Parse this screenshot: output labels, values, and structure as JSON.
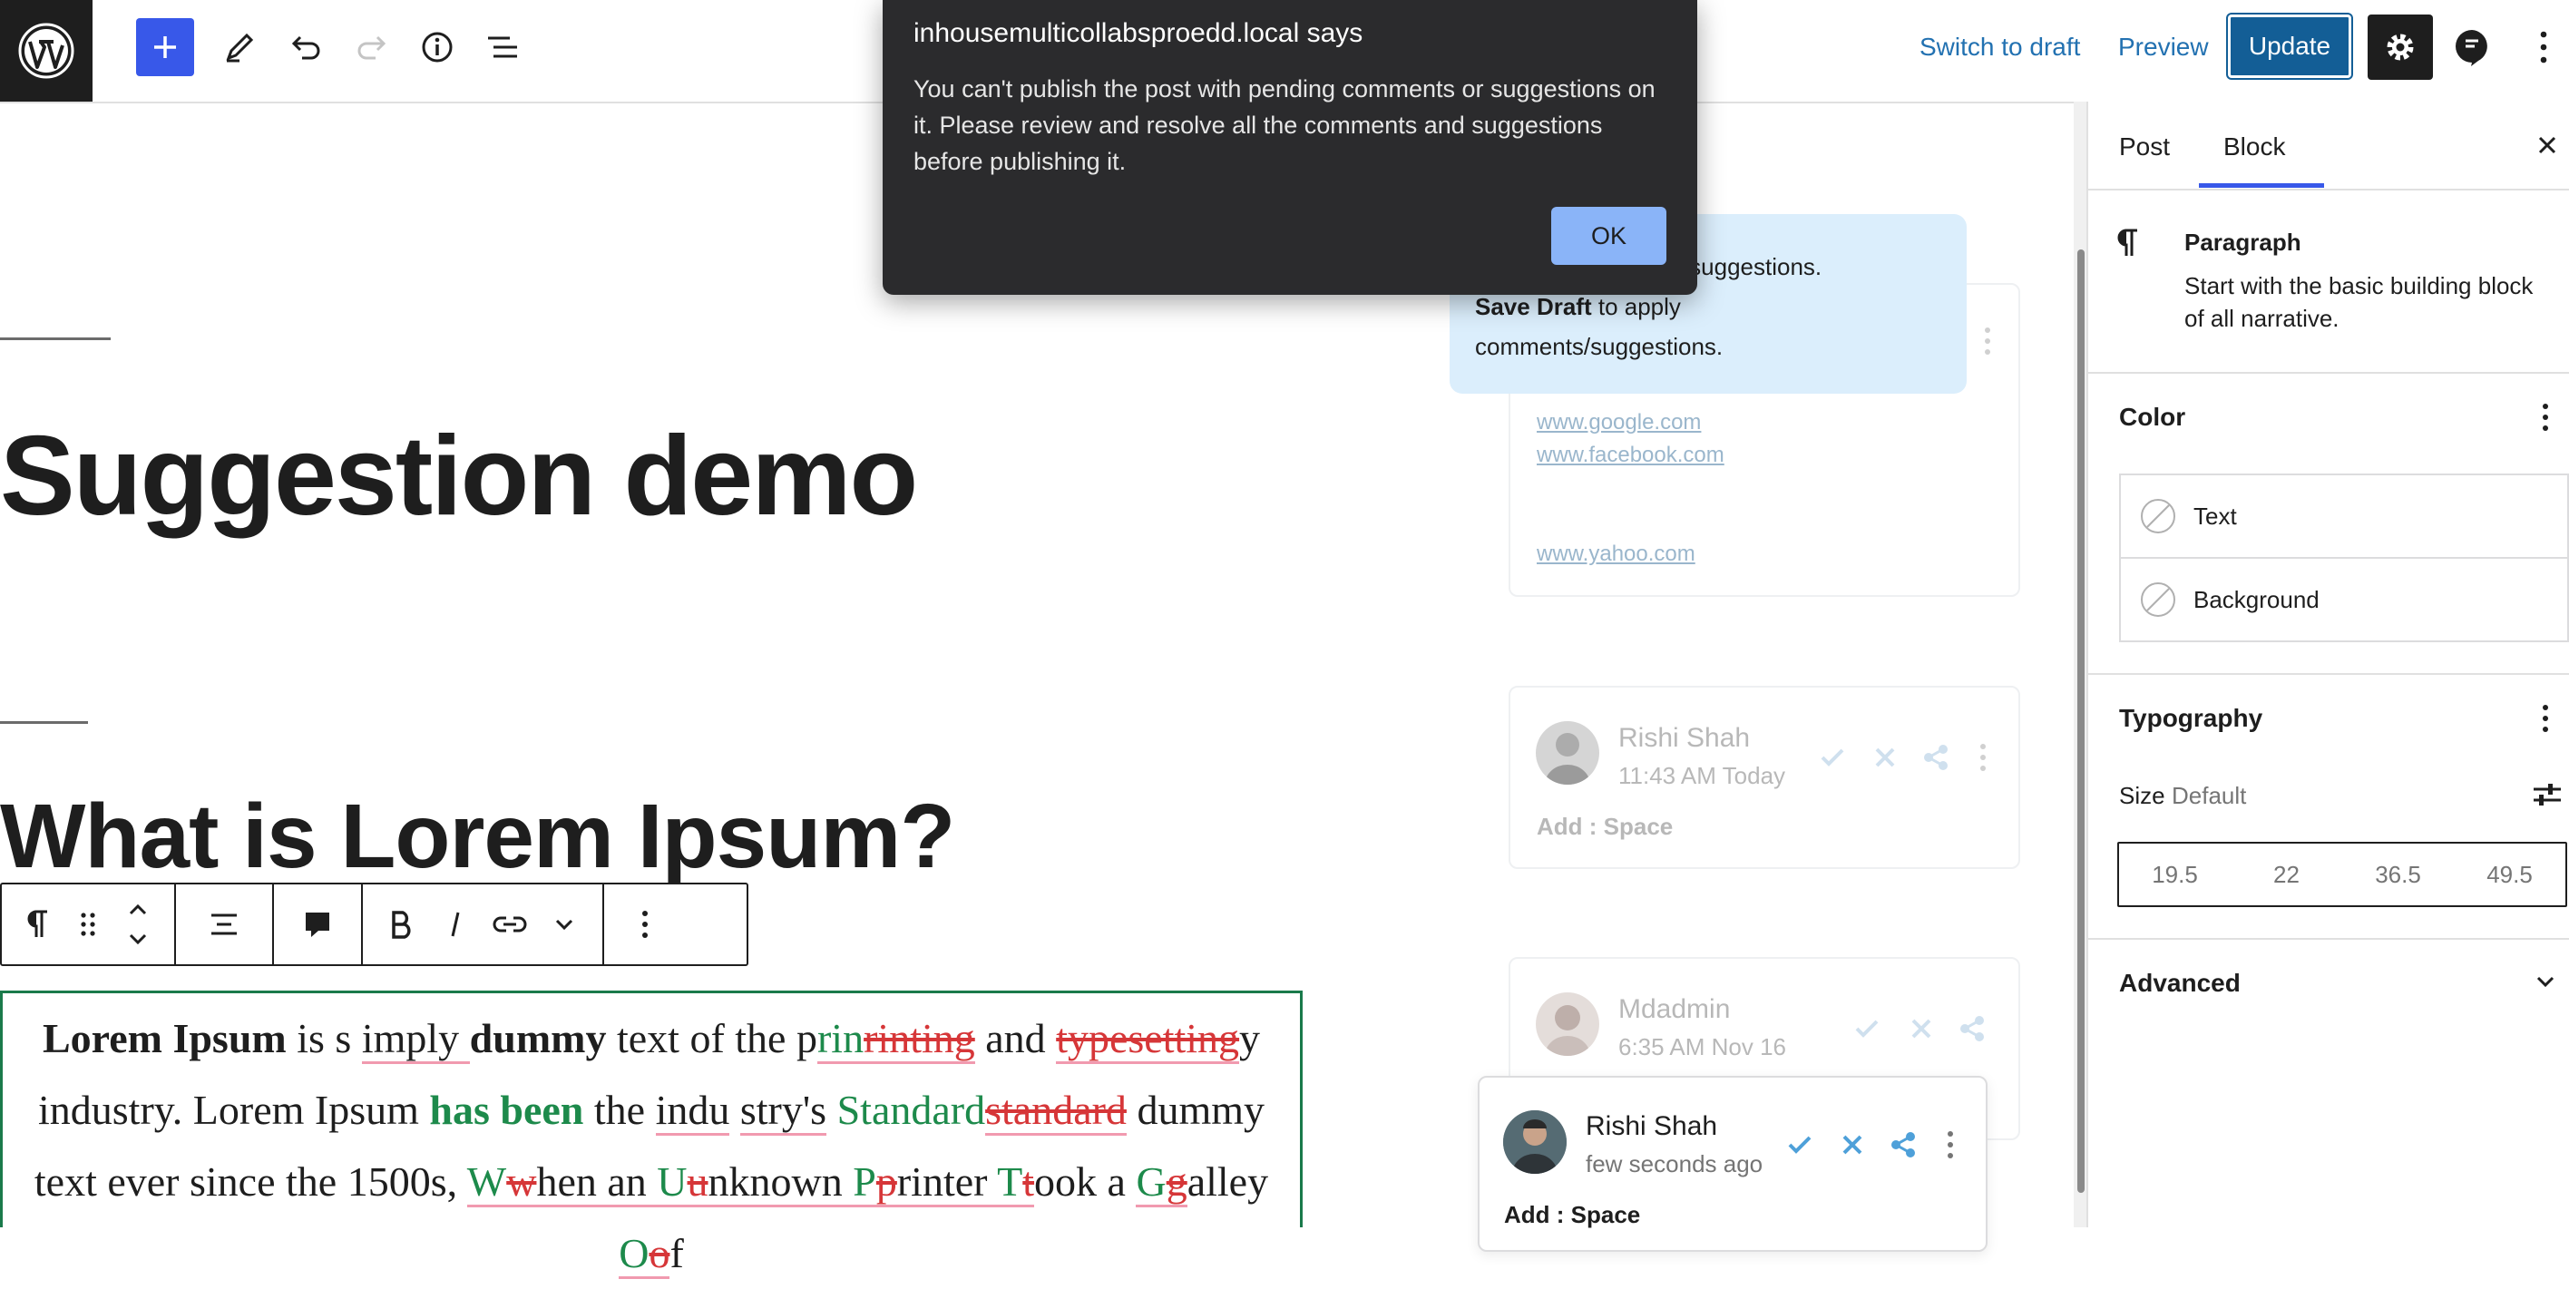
{
  "toolbar": {
    "switch_to_draft": "Switch to draft",
    "preview": "Preview",
    "update": "Update"
  },
  "editor": {
    "post_title": "Suggestion demo",
    "heading": "What is Lorem Ipsum?"
  },
  "notice": {
    "line1": "omments/suggestions.",
    "save_draft": "Save Draft",
    "line2_rest": " to apply",
    "line3": "comments/suggestions."
  },
  "links_card": {
    "links": [
      "www.google.com",
      "www.facebook.com",
      "www.yahoo.com"
    ]
  },
  "comments": [
    {
      "author": "Rishi Shah",
      "time": "11:43 AM Today",
      "body": "Add : Space"
    },
    {
      "author": "Mdadmin",
      "time": "6:35 AM Nov 16"
    },
    {
      "author": "Rishi Shah",
      "time": "few seconds ago",
      "body": "Add : Space"
    }
  ],
  "sidebar": {
    "tabs": [
      "Post",
      "Block"
    ],
    "active_tab": "Block",
    "block_name": "Paragraph",
    "block_desc_1": "Start with the basic building block",
    "block_desc_2": "of all narrative.",
    "color_title": "Color",
    "color_items": [
      "Text",
      "Background"
    ],
    "typography_title": "Typography",
    "size_label": "Size",
    "size_value": "Default",
    "size_options": [
      "19.5",
      "22",
      "36.5",
      "49.5"
    ],
    "advanced_title": "Advanced"
  },
  "dialog": {
    "title": "inhousemulticollabsproedd.local says",
    "message": "You can't publish the post with pending comments or suggestions on it. Please review and resolve all the comments and suggestions before publishing it.",
    "ok": "OK"
  },
  "paragraph": {
    "l1": [
      "Lorem Ipsum",
      " is s",
      "i",
      "mply ",
      "dummy",
      " text of the p",
      "rin",
      "rinting",
      " and ",
      "typesetting",
      "y"
    ],
    "l2": [
      "industry. Lorem Ip",
      "sum ",
      "has been",
      " the ",
      "indu",
      " ",
      "stry's",
      " ",
      "Standard",
      "standard",
      " dummy"
    ],
    "l3": [
      "text ever since the 1500s, ",
      "W",
      "w",
      "hen an ",
      "U",
      "u",
      "nknown ",
      "P",
      "p",
      "rinter ",
      "T",
      "t",
      "ook a ",
      "G",
      "g",
      "alley ",
      "O",
      "o",
      "f"
    ]
  },
  "icons": {
    "accent": "#3858e9",
    "update_bg": "#135e96",
    "insert_color": "#1d8a4b",
    "delete_color": "#d63638"
  }
}
